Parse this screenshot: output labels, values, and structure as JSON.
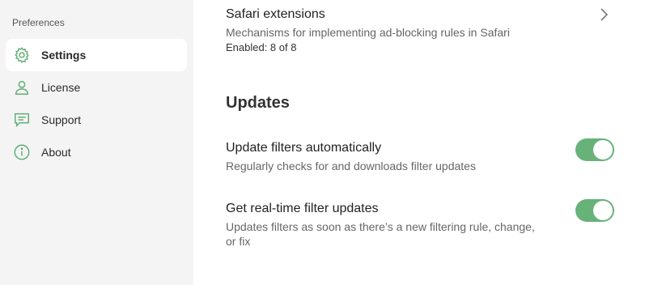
{
  "sidebar": {
    "title": "Preferences",
    "items": [
      {
        "label": "Settings",
        "icon": "gear-icon",
        "active": true
      },
      {
        "label": "License",
        "icon": "user-icon",
        "active": false
      },
      {
        "label": "Support",
        "icon": "chat-icon",
        "active": false
      },
      {
        "label": "About",
        "icon": "info-icon",
        "active": false
      }
    ]
  },
  "main": {
    "safari": {
      "title": "Safari extensions",
      "description": "Mechanisms for implementing ad-blocking rules in Safari",
      "status": "Enabled: 8 of 8",
      "icon": "chevron-right-icon"
    },
    "updates": {
      "heading": "Updates",
      "auto": {
        "title": "Update filters automatically",
        "description": "Regularly checks for and downloads filter updates",
        "enabled": true
      },
      "realtime": {
        "title": "Get real-time filter updates",
        "description_line1": "Updates filters as soon as there’s a new filtering rule, change,",
        "description_line2": "or fix",
        "enabled": true
      }
    }
  },
  "colors": {
    "accent": "#67b279",
    "sidebar_bg": "#f4f4f4"
  }
}
